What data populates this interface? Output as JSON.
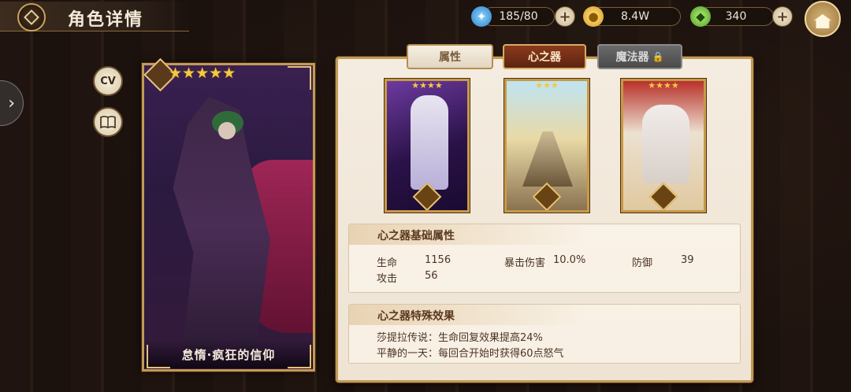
{
  "header": {
    "title": "角色详情",
    "stamina": "185/80",
    "gold": "8.4W",
    "gems": "340"
  },
  "side_buttons": {
    "cv_label": "CV"
  },
  "character": {
    "name": "怠惰·疯狂的信仰",
    "stars": "★★★★★"
  },
  "tabs": [
    {
      "label": "属性"
    },
    {
      "label": "心之器"
    },
    {
      "label": "魔法器"
    }
  ],
  "cards": [
    {
      "stars": "★★★★"
    },
    {
      "stars": "★★★"
    },
    {
      "stars": "★★★★"
    }
  ],
  "base_stats": {
    "title": "心之器基础属性",
    "hp_label": "生命",
    "hp_value": "1156",
    "crit_label": "暴击伤害",
    "crit_value": "10.0%",
    "def_label": "防御",
    "def_value": "39",
    "atk_label": "攻击",
    "atk_value": "56"
  },
  "special": {
    "title": "心之器特殊效果",
    "effect1": "莎提拉传说：生命回复效果提高24%",
    "effect2": "平静的一天：每回合开始时获得60点怒气"
  },
  "colors": {
    "accent_gold": "#c49a55",
    "active_tab": "#8a3a1c",
    "star": "#f5c842"
  }
}
